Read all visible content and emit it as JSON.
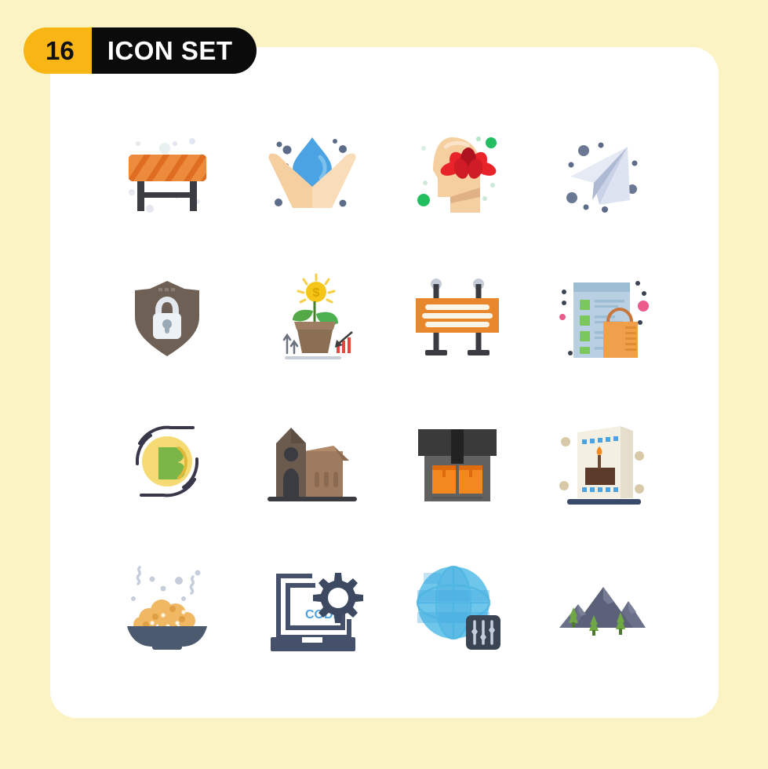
{
  "background_color": "#FBF3C4",
  "card_color": "#FFFFFF",
  "header": {
    "count": "16",
    "title": "ICON SET",
    "count_bg": "#F9B513",
    "title_bg": "#0B0B0B",
    "count_text_color": "#111111",
    "title_text_color": "#FFFFFF"
  },
  "grid": {
    "columns": 4,
    "rows": 4,
    "total": 16
  },
  "icons": [
    {
      "position": 1,
      "row": 1,
      "col": 1,
      "name": "barrier-icon",
      "label": "Barrier",
      "colors": [
        "#E8762C",
        "#F08B3E",
        "#3E3E3E"
      ]
    },
    {
      "position": 2,
      "row": 1,
      "col": 2,
      "name": "water-drop-hands-icon",
      "label": "Save Water",
      "colors": [
        "#4BA3E3",
        "#F6D0A4",
        "#5A6B8C"
      ]
    },
    {
      "position": 3,
      "row": 1,
      "col": 3,
      "name": "mindfulness-head-lotus-icon",
      "label": "Mindfulness",
      "colors": [
        "#F5CFA0",
        "#E8232A",
        "#23BE5F"
      ]
    },
    {
      "position": 4,
      "row": 1,
      "col": 4,
      "name": "paper-plane-icon",
      "label": "Send",
      "colors": [
        "#DDE3F0",
        "#5C6B87"
      ]
    },
    {
      "position": 5,
      "row": 2,
      "col": 1,
      "name": "shield-lock-icon",
      "label": "Security",
      "colors": [
        "#6E6055",
        "#D7DEE5"
      ]
    },
    {
      "position": 6,
      "row": 2,
      "col": 2,
      "name": "startup-growth-icon",
      "label": "Startup Growth",
      "colors": [
        "#8B6F55",
        "#4CAF50",
        "#F5C518",
        "#E8453C"
      ]
    },
    {
      "position": 7,
      "row": 2,
      "col": 3,
      "name": "signboard-icon",
      "label": "Signboard",
      "colors": [
        "#E8872C",
        "#3E3E3E",
        "#FAF5E6"
      ]
    },
    {
      "position": 8,
      "row": 2,
      "col": 4,
      "name": "shopping-list-bag-icon",
      "label": "Shopping List",
      "colors": [
        "#B9D0E2",
        "#7BC85A",
        "#F0A04B",
        "#ED5B8D"
      ]
    },
    {
      "position": 9,
      "row": 3,
      "col": 1,
      "name": "bitcoin-coin-icon",
      "label": "Bitcoin",
      "colors": [
        "#F6DB74",
        "#7AB648",
        "#38384A"
      ]
    },
    {
      "position": 10,
      "row": 3,
      "col": 2,
      "name": "church-building-icon",
      "label": "Church",
      "colors": [
        "#6B5A4E",
        "#9E7B5F",
        "#3E3E3E"
      ]
    },
    {
      "position": 11,
      "row": 3,
      "col": 3,
      "name": "warehouse-store-icon",
      "label": "Warehouse",
      "colors": [
        "#333333",
        "#616161",
        "#F3881F"
      ]
    },
    {
      "position": 12,
      "row": 3,
      "col": 4,
      "name": "birthday-card-icon",
      "label": "Greeting Card",
      "colors": [
        "#F3EFE2",
        "#5B3A29",
        "#4BA3E3",
        "#3A4A6B"
      ]
    },
    {
      "position": 13,
      "row": 4,
      "col": 1,
      "name": "food-bowl-icon",
      "label": "Food Bowl",
      "colors": [
        "#4B5A6E",
        "#F0B863",
        "#C6CEDB"
      ]
    },
    {
      "position": 14,
      "row": 4,
      "col": 2,
      "name": "laptop-code-gear-icon",
      "label": "CODE",
      "colors": [
        "#45516B",
        "#4BA3E3"
      ]
    },
    {
      "position": 15,
      "row": 4,
      "col": 3,
      "name": "globe-settings-icon",
      "label": "Global Settings",
      "colors": [
        "#6FC6EB",
        "#3BA7DE",
        "#3A4452"
      ]
    },
    {
      "position": 16,
      "row": 4,
      "col": 4,
      "name": "mountains-trees-icon",
      "label": "Mountains",
      "colors": [
        "#5B6179",
        "#6FA845"
      ]
    }
  ],
  "icon_labels": {
    "i1": "Barrier",
    "i2": "Save Water",
    "i3": "Mindfulness",
    "i4": "Send",
    "i5": "Security",
    "i6": "Startup Growth",
    "i7": "Signboard",
    "i8": "Shopping List",
    "i9": "Bitcoin",
    "i10": "Church",
    "i11": "Warehouse",
    "i12": "Greeting Card",
    "i13": "Food Bowl",
    "i14": "CODE",
    "i15": "Global Settings",
    "i16": "Mountains"
  },
  "laptop_code_text": "CODE"
}
